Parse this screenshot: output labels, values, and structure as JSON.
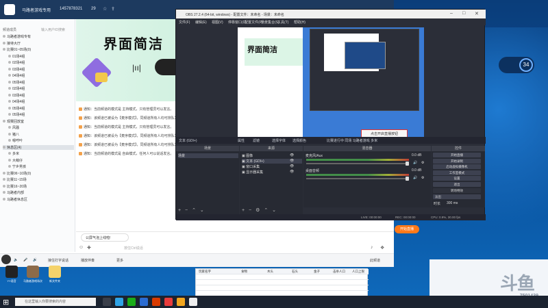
{
  "yy": {
    "channel_name": "马路者游戏专用",
    "channel_id": "1457878321",
    "online": "29",
    "tree_header": "频道成员",
    "tree_header_right": "输入用户ID搜索",
    "tree": [
      {
        "label": "马路者游戏专有"
      },
      {
        "label": "接待大厅"
      },
      {
        "label": "比赛01~05场(0)"
      },
      {
        "label": "01场4组"
      },
      {
        "label": "02场4组"
      },
      {
        "label": "03场4组"
      },
      {
        "label": "04场4组"
      },
      {
        "label": "05场4组"
      },
      {
        "label": "02场4组"
      },
      {
        "label": "03场4组"
      },
      {
        "label": "04场4组"
      },
      {
        "label": "05场4组"
      },
      {
        "label": "05场4组"
      },
      {
        "label": "观赛回放室"
      },
      {
        "label": "风骚"
      },
      {
        "label": "猪八"
      },
      {
        "label": "嗯哼叶"
      },
      {
        "label": "休息区(4)"
      },
      {
        "label": "多米"
      },
      {
        "label": "大萌仔"
      },
      {
        "label": "宁乡男孩"
      },
      {
        "label": "比赛06~10场(0)"
      },
      {
        "label": "比赛11~15场"
      },
      {
        "label": "比赛16~20场"
      },
      {
        "label": "马路者内部"
      },
      {
        "label": "马路者休息区"
      }
    ],
    "banner_title": "界面简洁",
    "chat": [
      "通知：当前频道的模式是 主持模式，只有管理员可以发言。",
      "通知：该频道已被设为【麦序模式】，同频道所有人均可排队发言。",
      "通知：当前频道的模式是 主持模式，只有管理员可以发言。",
      "通知：该频道已被设为【麦序模式】，同频道所有人均可排队发言。",
      "通知：该频道已被设为【麦序模式】，同频道所有人均可排队发言。",
      "通知：当前频道的模式是 自由模式，任何人可以说话发言。"
    ],
    "bubble": "公屏气泡上线啦!",
    "input_placeholder": "按住Ctrl说话",
    "bottom": {
      "mode": "接住打字说话",
      "play": "播放伴奏",
      "more": "更多",
      "search": "此频道"
    },
    "start_live": "开始直播"
  },
  "desktop_icons": [
    {
      "label": "YY语音"
    },
    {
      "label": "马路者游戏场次"
    },
    {
      "label": "新文件夹"
    }
  ],
  "widget": {
    "value": "34",
    "unit": "%"
  },
  "badge": {
    "logo": "斗鱼",
    "number": "7501439"
  },
  "obs": {
    "title": "OBS 27.2.4 (64-bit, windows) - 配置文件：未命名 - 场景：未命名",
    "menu": [
      "文件(F)",
      "编辑(E)",
      "视图(V)",
      "停靠窗口(D)",
      "配置文件(P)",
      "场景集合(S)",
      "工具(T)",
      "帮助(H)"
    ],
    "toast": "点击开启直播按钮",
    "source_bar": {
      "label": "文本 (GDI+)",
      "props": "属性",
      "filters": "滤镜",
      "text_btn": "选择字体",
      "align_btn": "选择颜色",
      "scroll_text": "比赛进行中 同场 马路者游戏 多米"
    },
    "docks": {
      "scenes": "场景",
      "sources": "来源",
      "mixer": "混音器",
      "transitions": "转场特效",
      "controls": "控件"
    },
    "scene_items": [
      "场景"
    ],
    "source_items": [
      "图像",
      "文本 (GDI+)",
      "窗口采集",
      "显示器采集"
    ],
    "mixer": [
      {
        "name": "麦克风/Aux",
        "db": "0.0 dB"
      },
      {
        "name": "桌面音频",
        "db": "0.0 dB"
      }
    ],
    "controls": [
      "开始直播",
      "开始录制",
      "启动虚拟摄像机",
      "工作室模式",
      "设置",
      "退出"
    ],
    "transition": {
      "label": "转场特效",
      "value": "淡出",
      "duration_label": "时长",
      "duration": "300 ms"
    },
    "status": {
      "live": "LIVE: 00:00:00",
      "rec": "REC: 00:00:00",
      "cpu": "CPU: 0.9%, 30.00 fps"
    }
  },
  "sheet": {
    "headers": [
      "玩家名字",
      "食物",
      "木头",
      "石头",
      "金子",
      "击杀人口",
      "人口上限"
    ]
  },
  "taskbar": {
    "search_placeholder": "在这里输入你要搜索的内容"
  }
}
